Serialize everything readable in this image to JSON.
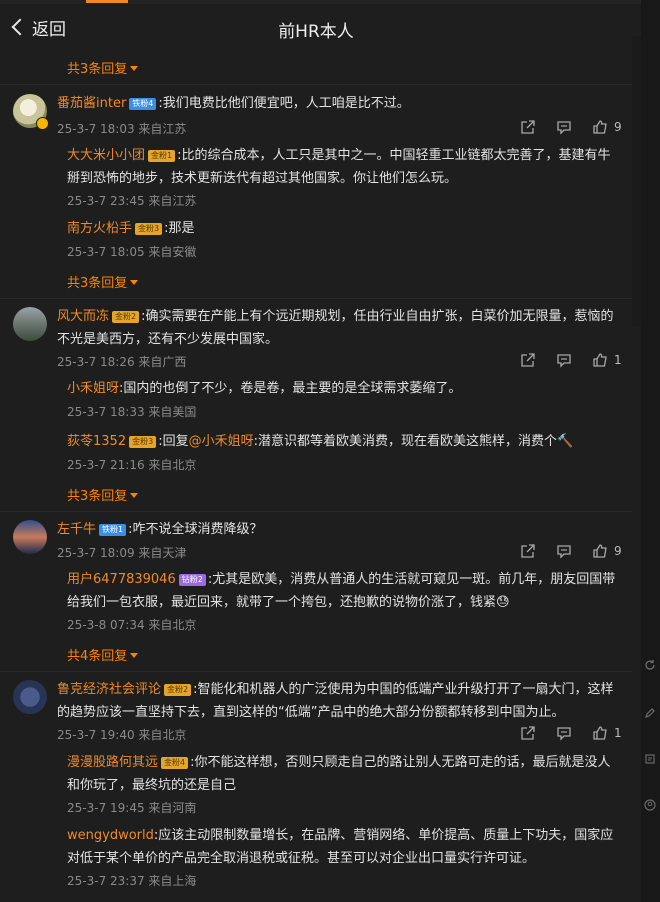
{
  "header": {
    "back_label": "返回",
    "title": "前HR本人"
  },
  "comments": [
    {
      "top_more": "共3条回复",
      "user": "番茄酱inter",
      "level": "铁粉4",
      "text": ":我们电费比他们便宜吧，人工咱是比不过。",
      "meta": "25-3-7 18:03 来自江苏",
      "likes": "9",
      "replies": [
        {
          "user": "大大米小小团",
          "level": "金粉1",
          "text": ":比的综合成本，人工只是其中之一。中国轻重工业链都太完善了，基建有牛掰到恐怖的地步，技术更新迭代有超过其他国家。你让他们怎么玩。",
          "meta": "25-3-7 23:45 来自江苏"
        },
        {
          "user": "南方火柗手",
          "level": "金粉3",
          "text": ":那是",
          "meta": "25-3-7 18:05 来自安徽"
        }
      ],
      "more": "共3条回复"
    },
    {
      "user": "风大而冻",
      "level": "金粉2",
      "text": ":确实需要在产能上有个远近期规划，任由行业自由扩张，白菜价加无限量，惹恼的不光是美西方，还有不少发展中国家。",
      "meta": "25-3-7 18:26 来自广西",
      "likes": "1",
      "replies": [
        {
          "user": "小禾姐呀",
          "level": "",
          "text": ":国内的也倒了不少，卷是卷，最主要的是全球需求萎缩了。",
          "meta": "25-3-7 18:33 来自美国"
        },
        {
          "user": "荻苓1352",
          "level": "金粉3",
          "text_pre": ":回复",
          "mention": "@小禾姐呀",
          "text": ":潜意识都等着欧美消费，现在看欧美这熊样，消费个🔨",
          "meta": "25-3-7 21:16 来自北京"
        }
      ],
      "more": "共3条回复"
    },
    {
      "user": "左千牛",
      "level": "铁粉1",
      "text": ":咋不说全球消费降级？",
      "meta": "25-3-7 18:09 来自天津",
      "likes": "9",
      "replies": [
        {
          "user": "用户6477839046",
          "level": "钻粉2",
          "text": ":尤其是欧美，消费从普通人的生活就可窥见一斑。前几年，朋友回国带给我们一包衣服，最近回来，就带了一个挎包，还抱歉的说物价涨了，钱紧😓",
          "meta": "25-3-8 07:34 来自北京"
        }
      ],
      "more": "共4条回复"
    },
    {
      "user": "鲁克经济社会评论",
      "level": "金粉2",
      "text": ":智能化和机器人的广泛使用为中国的低端产业升级打开了一扇大门，这样的趋势应该一直坚持下去，直到这样的“低端”产品中的绝大部分份额都转移到中国为止。",
      "meta": "25-3-7 19:40 来自北京",
      "likes": "1",
      "replies": [
        {
          "user": "漫漫股路何其远",
          "level": "金粉4",
          "text": ":你不能这样想，否则只顾走自己的路让别人无路可走的话，最后就是没人和你玩了，最终坑的还是自己",
          "meta": "25-3-7 19:45 来自河南"
        },
        {
          "user": "wengydworld",
          "level": "",
          "text": ":应该主动限制数量增长，在品牌、营销网络、单价提高、质量上下功夫，国家应对低于某个单价的产品完全取消退税或征税。甚至可以对企业出口量实行许可证。",
          "meta": "25-3-7 23:37 来自上海"
        }
      ]
    }
  ],
  "colors": {
    "accent": "#ff8200",
    "username": "#f08a2a",
    "background": "#1e1e1e"
  },
  "icons": [
    "share-icon",
    "comment-icon",
    "like-icon",
    "refresh-icon",
    "edit-icon",
    "history-icon",
    "profile-icon"
  ]
}
